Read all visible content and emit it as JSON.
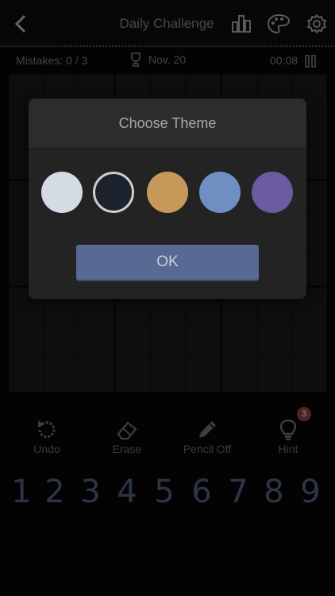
{
  "header": {
    "title": "Daily Challenge"
  },
  "status": {
    "mistakes": "Mistakes: 0 / 3",
    "date": "Nov. 20",
    "timer": "00:08"
  },
  "dialog": {
    "title": "Choose Theme",
    "themes": [
      {
        "color": "#d5dbe5",
        "selected": false
      },
      {
        "color": "#1d232e",
        "selected": true
      },
      {
        "color": "#c6995a",
        "selected": false
      },
      {
        "color": "#6d8fc1",
        "selected": false
      },
      {
        "color": "#6c5aa3",
        "selected": false
      }
    ],
    "ok_label": "OK"
  },
  "toolbar": {
    "undo_label": "Undo",
    "erase_label": "Erase",
    "pencil_label": "Pencil Off",
    "hint_label": "Hint",
    "hint_count": "3"
  },
  "numpad": [
    "1",
    "2",
    "3",
    "4",
    "5",
    "6",
    "7",
    "8",
    "9"
  ],
  "colors": {
    "accent": "#586a93",
    "digit": "#46516a",
    "badge": "#7a3838"
  }
}
